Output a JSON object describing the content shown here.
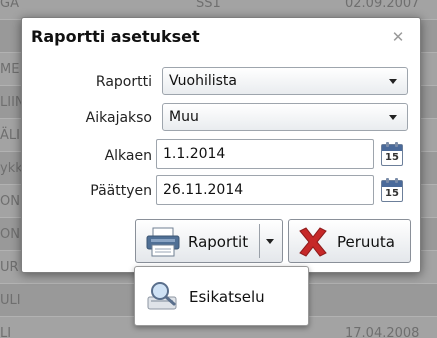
{
  "background": {
    "rows": [
      {
        "c1": "GA",
        "c2": "SS1",
        "c3": "02.09.2007"
      },
      {
        "c1": "",
        "c2": "",
        "c3": ""
      },
      {
        "c1": "ME",
        "c2": "",
        "c3": ""
      },
      {
        "c1": "LIIN",
        "c2": "",
        "c3": ""
      },
      {
        "c1": "ÄLI",
        "c2": "",
        "c3": ""
      },
      {
        "c1": "ykk",
        "c2": "",
        "c3": ""
      },
      {
        "c1": "ON",
        "c2": "",
        "c3": ""
      },
      {
        "c1": "ON",
        "c2": "",
        "c3": ""
      },
      {
        "c1": "UR",
        "c2": "",
        "c3": ""
      },
      {
        "c1": "ULI",
        "c2": "",
        "c3": ""
      },
      {
        "c1": "LI",
        "c2": "",
        "c3": "17.04.2008"
      }
    ]
  },
  "dialog": {
    "title": "Raportti asetukset",
    "close_glyph": "✕",
    "fields": {
      "report_label": "Raportti",
      "report_value": "Vuohilista",
      "period_label": "Aikajakso",
      "period_value": "Muu",
      "start_label": "Alkaen",
      "start_value": "1.1.2014",
      "end_label": "Päättyen",
      "end_value": "26.11.2014",
      "calendar_number": "15"
    },
    "buttons": {
      "reports_label": "Raportit",
      "cancel_label": "Peruuta"
    }
  },
  "menu": {
    "items": [
      {
        "label": "Esikatselu",
        "icon": "magnifier-preview-icon"
      }
    ]
  },
  "colors": {
    "overlay": "#9a9a9a",
    "cancel_x": "#c62828",
    "calendar_header": "#4a6a9a",
    "printer": "#4f6f95"
  }
}
